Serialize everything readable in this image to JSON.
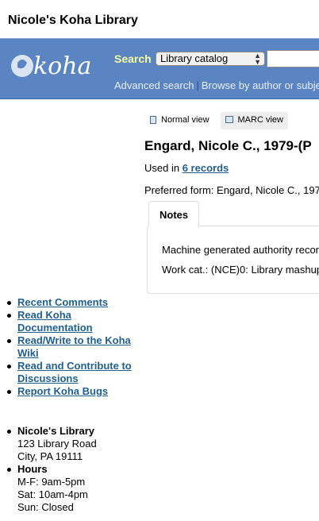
{
  "site": {
    "title": "Nicole's Koha Library"
  },
  "header": {
    "logo_text": "koha",
    "search_label": "Search",
    "catalog_select": "Library catalog",
    "search_value": "",
    "advanced_search": "Advanced search",
    "browse_link": "Browse by author or subject",
    "separator": "|"
  },
  "tabs": [
    {
      "label": "Normal view",
      "icon": "document-icon"
    },
    {
      "label": "MARC view",
      "icon": "marc-table-icon"
    }
  ],
  "record": {
    "title": "Engard, Nicole C., 1979-(P",
    "used_in_prefix": "Used in ",
    "used_in_link": "6 records",
    "preferred_form": "Preferred form: Engard, Nicole C., 197"
  },
  "notes": {
    "tab_label": "Notes",
    "line1": "Machine generated authority recor",
    "line2": "Work cat.: (NCE)0: Library mashup"
  },
  "sidebar_links": [
    "Recent Comments",
    "Read Koha Documentation",
    "Read/Write to the Koha Wiki",
    "Read and Contribute to Discussions",
    "Report Koha Bugs"
  ],
  "library_info": {
    "name": "Nicole's Library",
    "address1": "123 Library Road",
    "address2": "City, PA 19111",
    "hours_heading": "Hours",
    "hours": [
      "M-F: 9am-5pm",
      "Sat: 10am-4pm",
      "Sun: Closed"
    ]
  },
  "colors": {
    "header": "#5b85c2",
    "search_label": "#f4ff9d",
    "link": "#1f5f8f"
  }
}
